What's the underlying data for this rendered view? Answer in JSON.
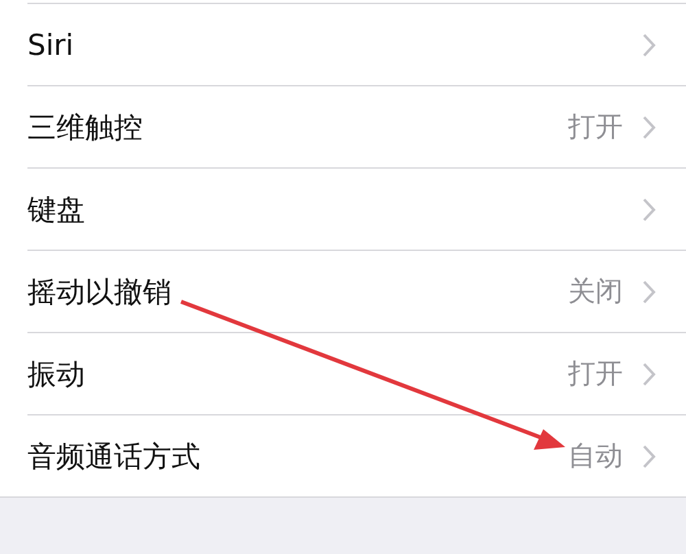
{
  "settings_list": [
    {
      "label": "Siri"
    },
    {
      "label": "三维触控",
      "value": "打开"
    },
    {
      "label": "键盘"
    },
    {
      "label": "摇动以撤销",
      "value": "关闭"
    },
    {
      "label": "振动",
      "value": "打开"
    },
    {
      "label": "音频通话方式",
      "value": "自动"
    }
  ],
  "annotations": [
    {
      "kind": "arrow"
    }
  ]
}
